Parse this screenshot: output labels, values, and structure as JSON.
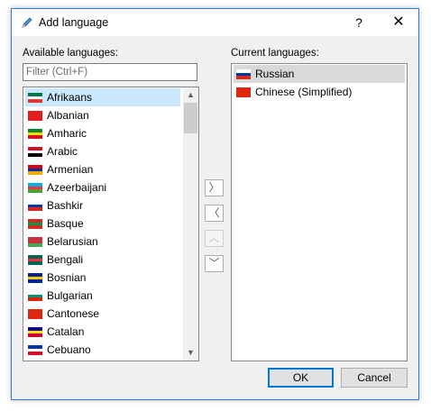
{
  "window": {
    "title": "Add language",
    "help_label": "?",
    "close_label": "✕"
  },
  "available": {
    "label": "Available languages:",
    "filter_placeholder": "Filter (Ctrl+F)",
    "items": [
      {
        "name": "Afrikaans",
        "flag": "za"
      },
      {
        "name": "Albanian",
        "flag": "al"
      },
      {
        "name": "Amharic",
        "flag": "et"
      },
      {
        "name": "Arabic",
        "flag": "eg"
      },
      {
        "name": "Armenian",
        "flag": "am"
      },
      {
        "name": "Azeerbaijani",
        "flag": "az"
      },
      {
        "name": "Bashkir",
        "flag": "ru"
      },
      {
        "name": "Basque",
        "flag": "eu"
      },
      {
        "name": "Belarusian",
        "flag": "by"
      },
      {
        "name": "Bengali",
        "flag": "bd"
      },
      {
        "name": "Bosnian",
        "flag": "ba"
      },
      {
        "name": "Bulgarian",
        "flag": "bg"
      },
      {
        "name": "Cantonese",
        "flag": "cn"
      },
      {
        "name": "Catalan",
        "flag": "ad"
      },
      {
        "name": "Cebuano",
        "flag": "ph"
      }
    ],
    "selected_index": 0
  },
  "current": {
    "label": "Current languages:",
    "items": [
      {
        "name": "Russian",
        "flag": "ru"
      },
      {
        "name": "Chinese (Simplified)",
        "flag": "cn"
      }
    ],
    "selected_index": 0
  },
  "move_buttons": {
    "add": "〉",
    "remove": "〈",
    "up": "︿",
    "down": "﹀"
  },
  "buttons": {
    "ok": "OK",
    "cancel": "Cancel"
  },
  "scrollbar": {
    "up": "▲",
    "down": "▼"
  },
  "flags": {
    "za": [
      "#007a4d",
      "#ffffff",
      "#de3831"
    ],
    "al": [
      "#e41e20",
      "#e41e20",
      "#e41e20"
    ],
    "et": [
      "#078930",
      "#fcdd09",
      "#da121a"
    ],
    "eg": [
      "#ce1126",
      "#ffffff",
      "#000000"
    ],
    "am": [
      "#d90012",
      "#0033a0",
      "#f2a800"
    ],
    "az": [
      "#00b5e2",
      "#ef3340",
      "#509e2f"
    ],
    "ru": [
      "#ffffff",
      "#0039a6",
      "#d52b1e"
    ],
    "eu": [
      "#d52b1e",
      "#009b48",
      "#d52b1e"
    ],
    "by": [
      "#c8313e",
      "#c8313e",
      "#4aa657"
    ],
    "bd": [
      "#006a4e",
      "#f42a41",
      "#006a4e"
    ],
    "ba": [
      "#002395",
      "#fecb00",
      "#002395"
    ],
    "bg": [
      "#ffffff",
      "#00966e",
      "#d62612"
    ],
    "cn": [
      "#de2910",
      "#de2910",
      "#de2910"
    ],
    "ad": [
      "#10069f",
      "#fedf00",
      "#d50032"
    ],
    "ph": [
      "#0038a8",
      "#ffffff",
      "#ce1126"
    ]
  }
}
